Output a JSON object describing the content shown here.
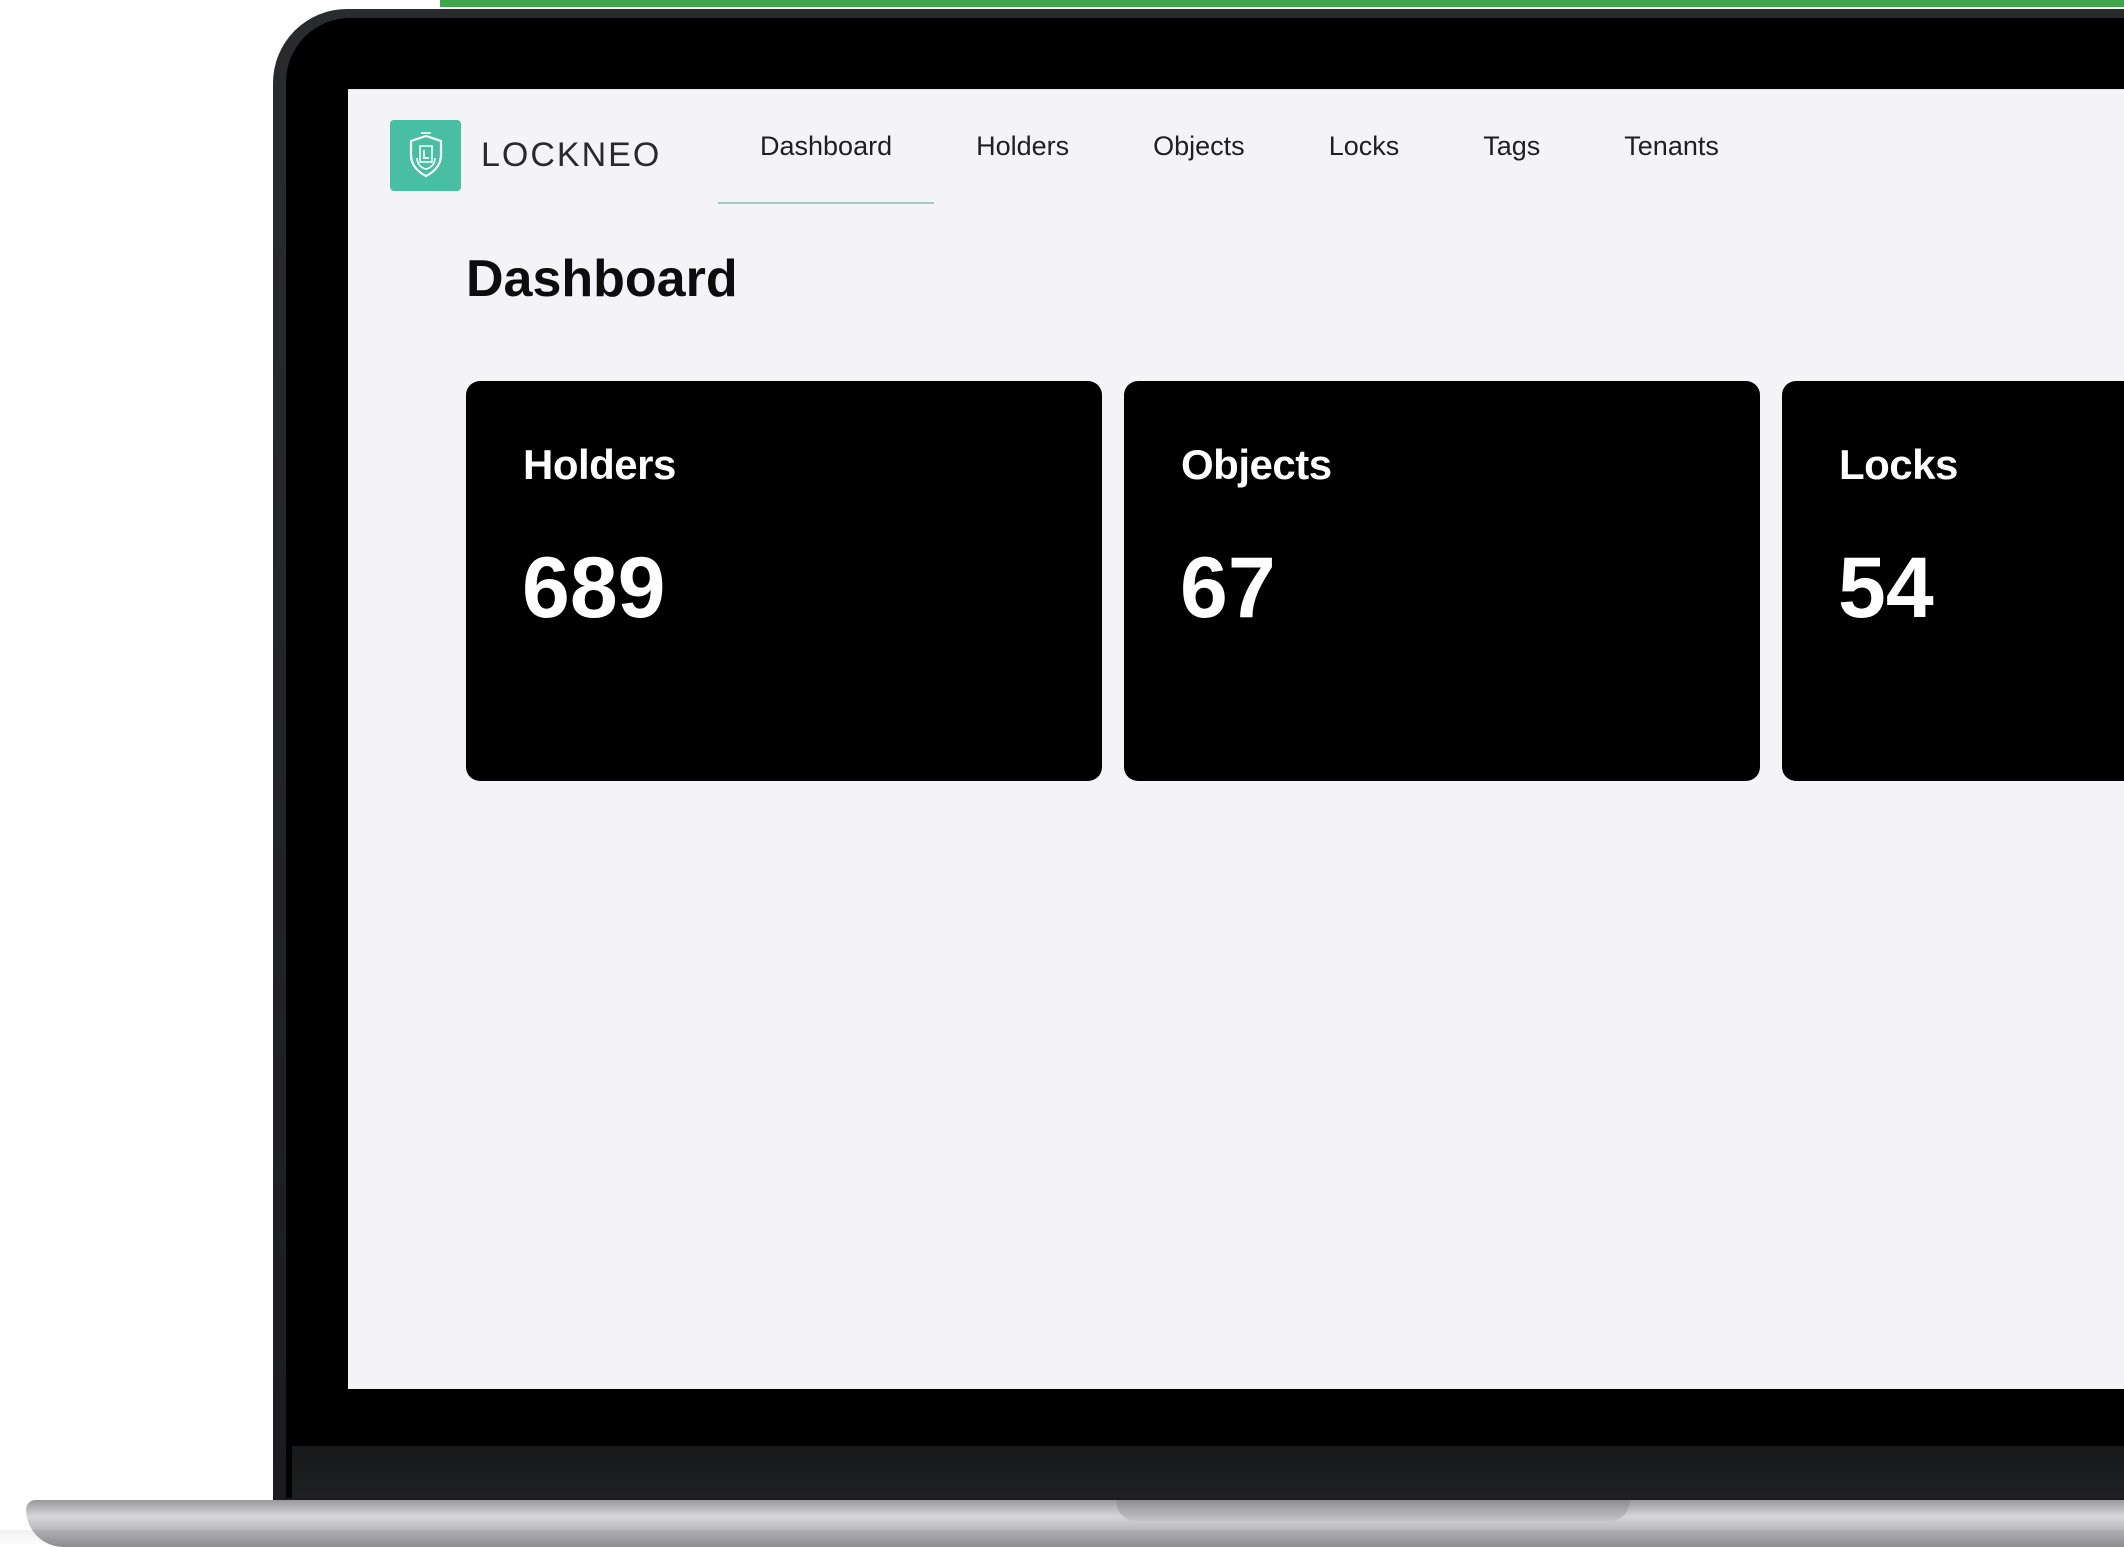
{
  "colors": {
    "accent_bar": "#3da74a",
    "logo_bg": "#48bfa4",
    "active_underline": "#9fcfc2",
    "screen_bg": "#f4f4f6",
    "card_bg": "#000000"
  },
  "brand": {
    "logo_icon": "shield-lock-icon",
    "name": "LOCKNEO"
  },
  "nav": {
    "items": [
      {
        "label": "Dashboard",
        "active": true
      },
      {
        "label": "Holders",
        "active": false
      },
      {
        "label": "Objects",
        "active": false
      },
      {
        "label": "Locks",
        "active": false
      },
      {
        "label": "Tags",
        "active": false
      },
      {
        "label": "Tenants",
        "active": false
      }
    ]
  },
  "page": {
    "title": "Dashboard"
  },
  "cards": [
    {
      "title": "Holders",
      "value": "689"
    },
    {
      "title": "Objects",
      "value": "67"
    },
    {
      "title": "Locks",
      "value": "54"
    }
  ]
}
